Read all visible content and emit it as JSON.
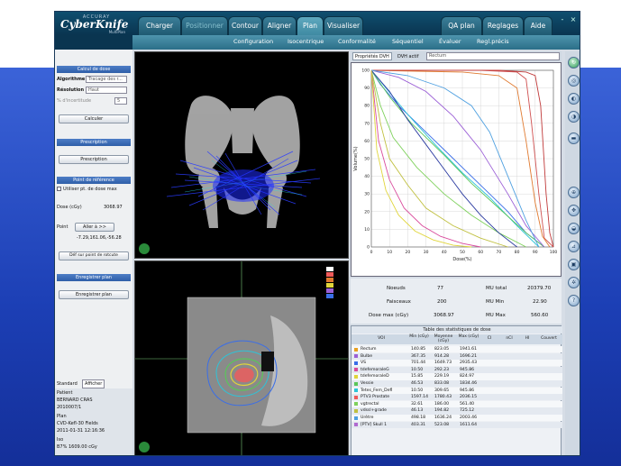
{
  "header": {
    "logo_top": "ACCURAY",
    "logo_main": "CyberKnife",
    "logo_sub": "MultiPlan",
    "tabs": [
      {
        "label": "Charger",
        "dim": false
      },
      {
        "label": "Positionner",
        "dim": true
      },
      {
        "label": "Contour",
        "dim": false
      },
      {
        "label": "Aligner",
        "dim": false
      },
      {
        "label": "Plan",
        "dim": false,
        "active": true
      },
      {
        "label": "Visualiser",
        "dim": false
      },
      {
        "label": "QA plan",
        "dim": false
      },
      {
        "label": "Reglages",
        "dim": false
      },
      {
        "label": "Aide",
        "dim": false
      }
    ],
    "window_buttons": [
      "-",
      "×"
    ]
  },
  "subnav": [
    "Configuration",
    "Isocentrique",
    "Conformalité",
    "Séquentiel",
    "Évaluer",
    "Regl.précis"
  ],
  "left_panel": {
    "dose_calc": {
      "title": "Calcul de dose",
      "algorithm_label": "Algorithme",
      "algorithm_value": "Tracage des r...",
      "resolution_label": "Résolution",
      "resolution_value": "Haut",
      "percent_label": "% d'incertitude",
      "percent_value": "5",
      "calculate_button": "Calculer"
    },
    "prescription": {
      "title": "Prescription",
      "button": "Prescription"
    },
    "reference_point": {
      "title": "Point de référence",
      "checkbox_label": "Utiliser pt. de dose max",
      "dose_label": "Dose (cGy)",
      "dose_value": "3068.97",
      "point_label": "Point",
      "goto_button": "Aller à >>",
      "coords": "-7.29,161.06,-56.28",
      "define_button": "Déf sur point de rotcute"
    },
    "save_plan": {
      "title": "Enregistrer plan",
      "button": "Enregistrer plan"
    },
    "lower_tabs": [
      "Standard",
      "Afficher"
    ],
    "patient": {
      "label1": "Patient",
      "name": "BERNARD CRAS",
      "id": "2010007/1",
      "label2": "Plan",
      "plan": "CVD-Kefl-30 Fields",
      "date": "2011-01-31 12:16:36",
      "label3": "Iso",
      "iso": "B7% 1609.00 cGy"
    }
  },
  "viewers": {
    "top_left_label": "",
    "bottom_left_legend": [
      "",
      "",
      "",
      "",
      ""
    ]
  },
  "dvh_panel": {
    "tabs": [
      "Propriétés DVH",
      "DVH actif"
    ],
    "selected": "Rectum",
    "xlabel": "Dose(%)",
    "ylabel": "Volume(%)"
  },
  "info": {
    "faisceaux_label": "Faisceaux",
    "faisceaux_value": "77",
    "noeuds_label": "Noeuds",
    "noeuds_value": "200",
    "dose_max_label": "Dose max (cGy)",
    "dose_max_value": "3068.97",
    "mu_total_label": "MU total",
    "mu_total_value": "20379.70",
    "mu_min_label": "MU Min",
    "mu_min_value": "22.90",
    "mu_max_label": "MU Max",
    "mu_max_value": "560.60"
  },
  "stats": {
    "title": "Table des statistiques de dose",
    "headers": [
      "VOI",
      "Min (cGy)",
      "Moyenne (cGy)",
      "Max (cGy)",
      "CI",
      "nCI",
      "HI",
      "Couvert"
    ],
    "rows": [
      {
        "name": "Rectum",
        "min": "140.85",
        "mean": "823.05",
        "max": "1941.61",
        "color": "#e8a020"
      },
      {
        "name": "Bulbe",
        "min": "367.35",
        "mean": "914.28",
        "max": "1696.21",
        "color": "#9b5fd6"
      },
      {
        "name": "VS",
        "min": "701.44",
        "mean": "1649.73",
        "max": "2935.43",
        "color": "#3a6ee8"
      },
      {
        "name": "tdefemoraleG",
        "min": "10.50",
        "mean": "292.23",
        "max": "945.86",
        "color": "#d94a9c"
      },
      {
        "name": "tdefemoraleD",
        "min": "15.85",
        "mean": "229.19",
        "max": "824.97",
        "color": "#e0d53a"
      },
      {
        "name": "Vessie",
        "min": "46.53",
        "mean": "833.08",
        "max": "1834.46",
        "color": "#5ac65a"
      },
      {
        "name": "Tetes_Fem_Defl",
        "min": "10.50",
        "mean": "309.65",
        "max": "945.86",
        "color": "#2ec4d8"
      },
      {
        "name": "PTV3 Prostate",
        "min": "1597.14",
        "mean": "1780.43",
        "max": "2036.15",
        "color": "#f05a5a"
      },
      {
        "name": "vgtrectal",
        "min": "32.61",
        "mean": "186.00",
        "max": "561.40",
        "color": "#7fd15c"
      },
      {
        "name": "vdssl+grade",
        "min": "46.13",
        "mean": "194.82",
        "max": "725.12",
        "color": "#c0c040"
      },
      {
        "name": "Urètre",
        "min": "498.18",
        "mean": "1636.24",
        "max": "2003.46",
        "color": "#4fa0e0"
      },
      {
        "name": "[PTV] Skull 1",
        "min": "403.31",
        "mean": "523.08",
        "max": "1611.64",
        "color": "#b06ad0"
      }
    ]
  },
  "chart_data": {
    "type": "line",
    "title": "",
    "xlabel": "Dose(%)",
    "ylabel": "Volume(%)",
    "xlim": [
      0,
      100
    ],
    "ylim": [
      0,
      100
    ],
    "xticks": [
      0,
      10,
      20,
      30,
      40,
      50,
      60,
      70,
      80,
      90,
      100
    ],
    "yticks": [
      0,
      10,
      20,
      30,
      40,
      50,
      60,
      70,
      80,
      90,
      100
    ],
    "grid": true,
    "series": [
      {
        "color": "#d05050",
        "x": [
          0,
          60,
          80,
          85,
          88,
          92,
          95,
          100
        ],
        "y": [
          100,
          100,
          99,
          95,
          70,
          30,
          5,
          0
        ]
      },
      {
        "color": "#e07a30",
        "x": [
          0,
          50,
          70,
          80,
          85,
          90,
          94,
          98
        ],
        "y": [
          100,
          99,
          97,
          90,
          60,
          25,
          6,
          0
        ]
      },
      {
        "color": "#c03a3a",
        "x": [
          0,
          70,
          85,
          90,
          93,
          96,
          98,
          100
        ],
        "y": [
          100,
          100,
          99,
          97,
          80,
          30,
          8,
          0
        ]
      },
      {
        "color": "#3a6ee8",
        "x": [
          0,
          5,
          15,
          30,
          45,
          60,
          75,
          85,
          95
        ],
        "y": [
          100,
          92,
          80,
          65,
          50,
          35,
          20,
          8,
          0
        ]
      },
      {
        "color": "#2ec4d8",
        "x": [
          0,
          8,
          20,
          35,
          50,
          65,
          80,
          92
        ],
        "y": [
          100,
          90,
          75,
          58,
          42,
          28,
          12,
          0
        ]
      },
      {
        "color": "#5ac65a",
        "x": [
          0,
          10,
          22,
          40,
          55,
          70,
          85,
          95
        ],
        "y": [
          100,
          85,
          70,
          52,
          36,
          22,
          8,
          0
        ]
      },
      {
        "color": "#7fd15c",
        "x": [
          0,
          5,
          12,
          25,
          40,
          55,
          70,
          85
        ],
        "y": [
          100,
          80,
          62,
          45,
          30,
          18,
          8,
          0
        ]
      },
      {
        "color": "#2a3aa0",
        "x": [
          0,
          10,
          20,
          30,
          40,
          50,
          60,
          70,
          80
        ],
        "y": [
          100,
          88,
          72,
          58,
          44,
          30,
          18,
          8,
          0
        ]
      },
      {
        "color": "#9b5fd6",
        "x": [
          0,
          15,
          30,
          45,
          60,
          75,
          85,
          95
        ],
        "y": [
          100,
          96,
          88,
          74,
          55,
          30,
          12,
          0
        ]
      },
      {
        "color": "#c0c040",
        "x": [
          0,
          5,
          10,
          20,
          30,
          45,
          60,
          75
        ],
        "y": [
          100,
          70,
          50,
          35,
          22,
          12,
          5,
          0
        ]
      },
      {
        "color": "#4fa0e0",
        "x": [
          0,
          20,
          40,
          55,
          65,
          75,
          85,
          92
        ],
        "y": [
          100,
          97,
          90,
          80,
          65,
          40,
          15,
          0
        ]
      },
      {
        "color": "#d94a9c",
        "x": [
          0,
          4,
          10,
          18,
          28,
          38,
          50,
          60
        ],
        "y": [
          100,
          60,
          38,
          22,
          12,
          6,
          2,
          0
        ]
      },
      {
        "color": "#e0d53a",
        "x": [
          0,
          3,
          8,
          15,
          24,
          34,
          45,
          55
        ],
        "y": [
          100,
          55,
          32,
          18,
          9,
          4,
          1,
          0
        ]
      }
    ]
  }
}
